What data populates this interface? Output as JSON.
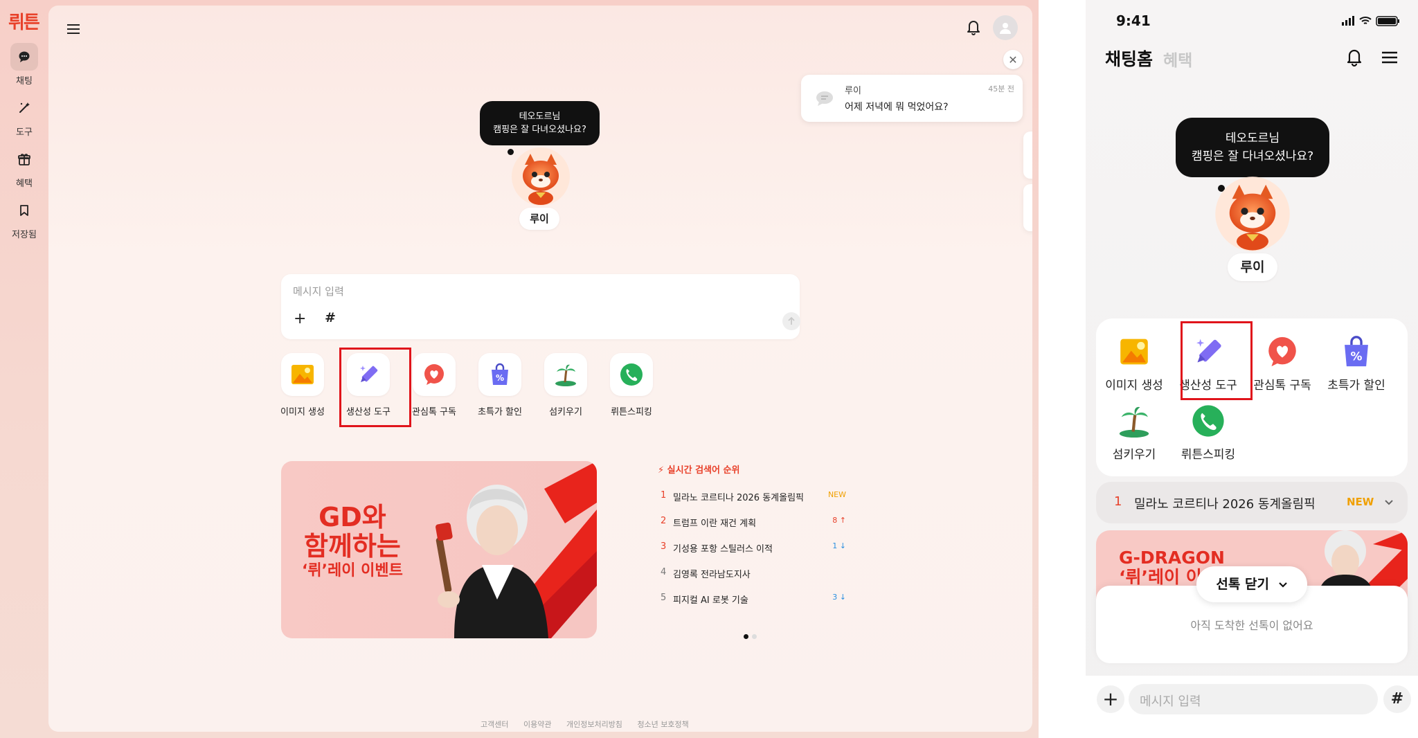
{
  "app": {
    "logo": "뤼튼",
    "accent": "#e8412a",
    "highlight_color": "#e0141b"
  },
  "rail": {
    "items": [
      {
        "label": "채팅",
        "icon": "chat-bubble-icon",
        "active": true
      },
      {
        "label": "도구",
        "icon": "magic-wand-icon",
        "active": false
      },
      {
        "label": "혜택",
        "icon": "gift-icon",
        "active": false
      },
      {
        "label": "저장됨",
        "icon": "bookmark-icon",
        "active": false
      }
    ]
  },
  "header": {
    "menu_icon": "hamburger-menu-icon",
    "bell_icon": "bell-icon",
    "avatar_icon": "user-avatar-icon"
  },
  "toast": {
    "name": "루이",
    "time": "45분 전",
    "message": "어제 저녁에 뭐 먹었어요?",
    "close_icon": "close-icon"
  },
  "character": {
    "bubble_line1": "테오도르님",
    "bubble_line2": "캠핑은 잘 다녀오셨나요?",
    "name": "루이"
  },
  "composer": {
    "placeholder": "메시지 입력",
    "plus": "+",
    "hash": "#"
  },
  "tools": [
    {
      "label": "이미지 생성",
      "icon": "image-generate-icon",
      "highlighted": false
    },
    {
      "label": "생산성 도구",
      "icon": "pen-sparkle-icon",
      "highlighted": true
    },
    {
      "label": "관심톡 구독",
      "icon": "heart-chat-icon",
      "highlighted": false
    },
    {
      "label": "초특가 할인",
      "icon": "discount-bag-icon",
      "highlighted": false
    },
    {
      "label": "섬키우기",
      "icon": "palm-island-icon",
      "highlighted": false
    },
    {
      "label": "뤼튼스피킹",
      "icon": "phone-call-icon",
      "highlighted": false
    }
  ],
  "banner": {
    "line1": "GD와",
    "line2": "함께하는",
    "line3": "‘뤼’레이 이벤트"
  },
  "trending": {
    "title": "실시간 검색어 순위",
    "items": [
      {
        "rank": "1",
        "text": "밀라노 코르티나 2026 동계올림픽",
        "badge": "NEW",
        "trend": "new"
      },
      {
        "rank": "2",
        "text": "트럼프 이란 재건 계획",
        "badge": "8 ↑",
        "trend": "up"
      },
      {
        "rank": "3",
        "text": "기성용 포항 스틸러스 이적",
        "badge": "1 ↓",
        "trend": "down"
      },
      {
        "rank": "4",
        "text": "김영록 전라남도지사",
        "badge": "",
        "trend": "none"
      },
      {
        "rank": "5",
        "text": "피지컬 AI 로봇 기술",
        "badge": "3 ↓",
        "trend": "down"
      }
    ],
    "colors": {
      "new": "#f0a000",
      "up": "#e8412a",
      "down": "#2a8fe0"
    }
  },
  "footer": {
    "links": [
      "고객센터",
      "이용약관",
      "개인정보처리방침",
      "청소년 보호정책"
    ]
  },
  "mobile": {
    "time": "9:41",
    "title": "채팅홈",
    "title2": "혜택",
    "bubble_line1": "테오도르님",
    "bubble_line2": "캠핑은 잘 다녀오셨나요?",
    "char_name": "루이",
    "trend": {
      "rank": "1",
      "text": "밀라노 코르티나 2026 동계올림픽",
      "badge": "NEW"
    },
    "banner_line1": "G-DRAGON",
    "banner_line2": "‘뤼’레이 이",
    "sheet_button": "선톡 닫기",
    "sheet_empty": "아직 도착한 선톡이 없어요",
    "input_placeholder": "메시지 입력",
    "plus": "+",
    "hash": "#"
  }
}
